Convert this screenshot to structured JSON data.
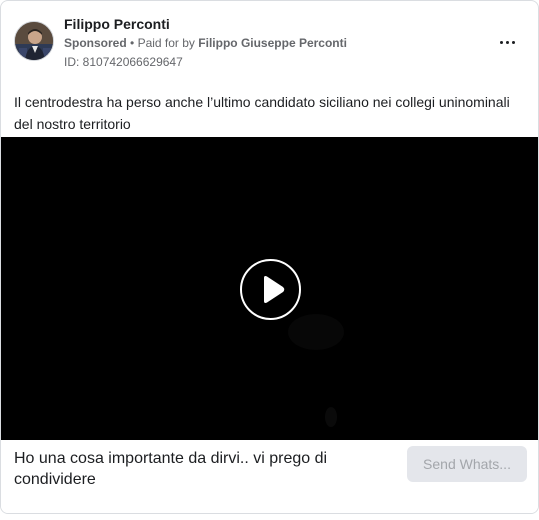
{
  "ad": {
    "advertiser_name": "Filippo Perconti",
    "sponsored_label": "Sponsored",
    "separator": "•",
    "paid_for_by_label": "Paid for by",
    "paid_for_by_name": "Filippo Giuseppe Perconti",
    "ad_id": "ID: 810742066629647",
    "more_icon": "more-horizontal-icon",
    "body_text": "Il centrodestra ha perso anche l’ultimo candidato siciliano nei collegi uninominali del nostro territorio"
  },
  "video": {
    "play_icon": "play-icon",
    "background": "#000000"
  },
  "footer": {
    "caption": "Ho una cosa importante da dirvi.. vi prego di condividere",
    "cta_label": "Send Whats..."
  },
  "colors": {
    "text_primary": "#1c1e21",
    "text_secondary": "#65676b",
    "border": "#dadde1",
    "button_bg": "#e4e6eb",
    "button_text": "#a3a6ab"
  }
}
